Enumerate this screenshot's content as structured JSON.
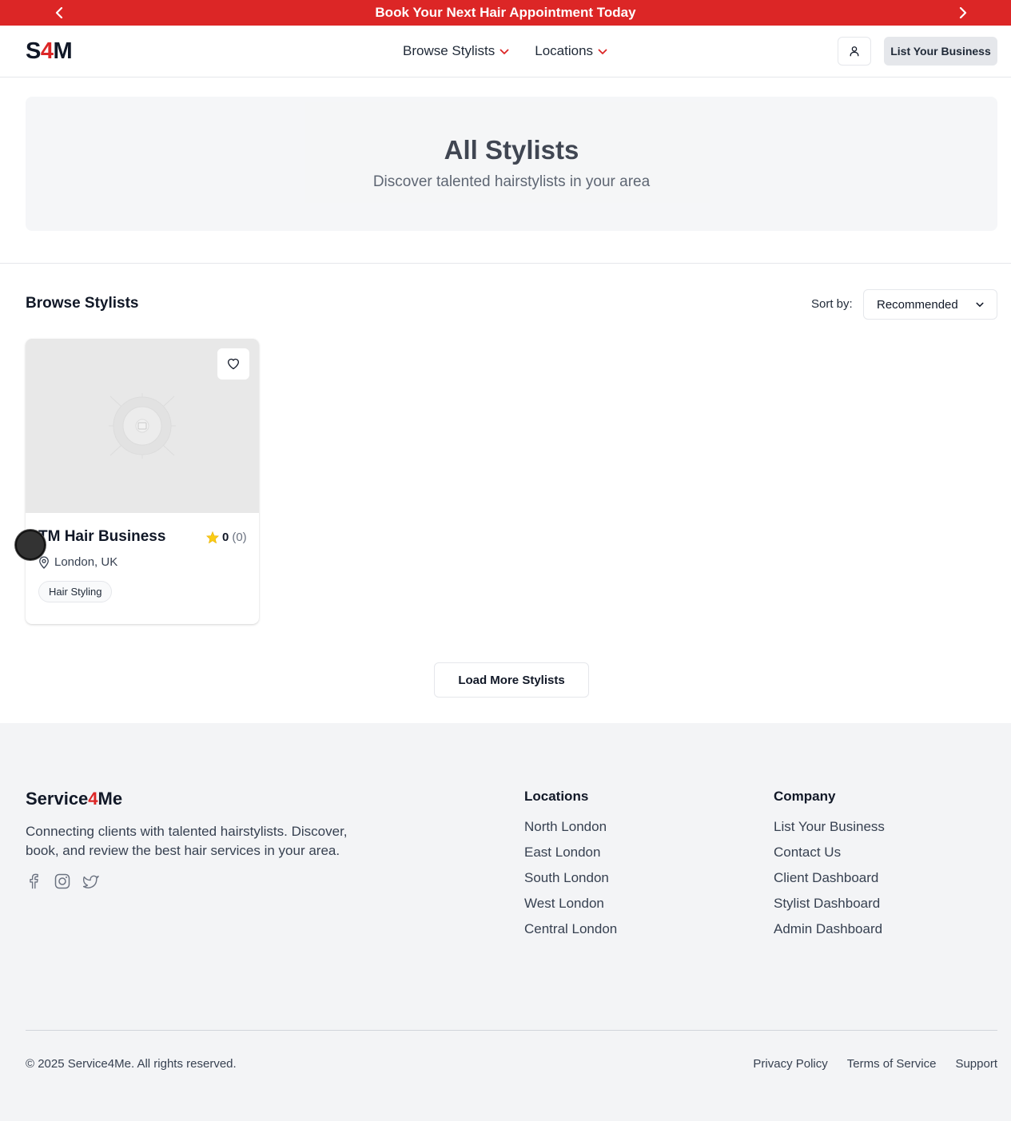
{
  "promo": {
    "text": "Book Your Next Hair Appointment Today",
    "prev_icon": "chevron-left-icon",
    "next_icon": "chevron-right-icon",
    "color": "#dc2626"
  },
  "header": {
    "logo_prefix": "S",
    "logo_accent": "4",
    "logo_suffix": "M",
    "nav": [
      {
        "label": "Browse Stylists",
        "icon": "chevron-down-icon"
      },
      {
        "label": "Locations",
        "icon": "chevron-down-icon"
      }
    ],
    "user_icon": "user-icon",
    "list_business_label": "List Your Business"
  },
  "hero": {
    "title": "All Stylists",
    "subtitle": "Discover talented hairstylists in your area"
  },
  "browse": {
    "title": "Browse Stylists",
    "sort_label": "Sort by:",
    "sort_value": "Recommended"
  },
  "cards": [
    {
      "name": "TM Hair Business",
      "rating": "0",
      "review_count": "(0)",
      "location": "London, UK",
      "tag": "Hair Styling"
    }
  ],
  "load_more_label": "Load More Stylists",
  "footer": {
    "brand_prefix": "Service",
    "brand_accent": "4",
    "brand_suffix": "Me",
    "description": "Connecting clients with talented hairstylists. Discover, book, and review the best hair services in your area.",
    "social_icons": [
      "facebook-icon",
      "instagram-icon",
      "twitter-icon"
    ],
    "locations_heading": "Locations",
    "locations": [
      "North London",
      "East London",
      "South London",
      "West London",
      "Central London"
    ],
    "company_heading": "Company",
    "company": [
      "List Your Business",
      "Contact Us",
      "Client Dashboard",
      "Stylist Dashboard",
      "Admin Dashboard"
    ],
    "copyright": "© 2025 Service4Me. All rights reserved.",
    "legal": [
      "Privacy Policy",
      "Terms of Service",
      "Support"
    ]
  },
  "colors": {
    "accent": "#dc2626",
    "star": "#facc15"
  }
}
